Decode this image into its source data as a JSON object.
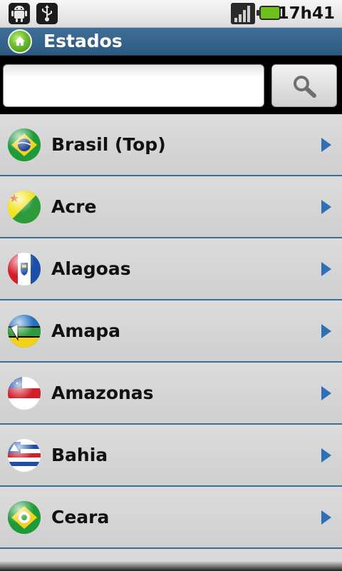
{
  "status_bar": {
    "icons": [
      "android-debug-icon",
      "usb-icon",
      "signal-icon",
      "battery-icon"
    ],
    "time": "17h41",
    "battery_color": "#6fbf1d"
  },
  "title_bar": {
    "icon": "home-icon",
    "title": "Estados"
  },
  "search": {
    "value": "",
    "placeholder": "",
    "button_icon": "search-icon"
  },
  "list": {
    "arrow_icon": "chevron-right-icon",
    "arrow_color": "#2e6fb8",
    "items": [
      {
        "label": "Brasil (Top)",
        "flag_icon": "brazil-flag-icon"
      },
      {
        "label": "Acre",
        "flag_icon": "acre-flag-icon"
      },
      {
        "label": "Alagoas",
        "flag_icon": "alagoas-flag-icon"
      },
      {
        "label": "Amapa",
        "flag_icon": "amapa-flag-icon"
      },
      {
        "label": "Amazonas",
        "flag_icon": "amazonas-flag-icon"
      },
      {
        "label": "Bahia",
        "flag_icon": "bahia-flag-icon"
      },
      {
        "label": "Ceara",
        "flag_icon": "ceara-flag-icon"
      }
    ]
  },
  "colors": {
    "title_bar": "#2d5a80",
    "divider": "#3f6f98",
    "list_background": "#d9d9d9"
  }
}
